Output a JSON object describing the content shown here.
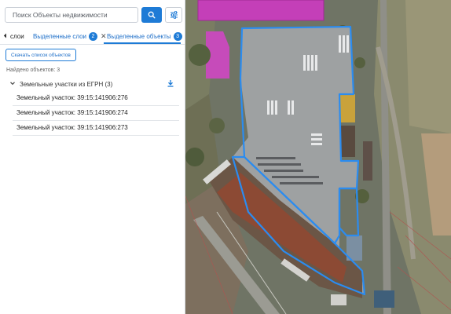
{
  "search": {
    "placeholder": "Поиск Объекты недвижимости"
  },
  "icons": {
    "search": "search-icon",
    "filter": "tune-icon",
    "back": "caret-left-icon",
    "close": "close-icon",
    "expand": "chevron-down-icon",
    "download": "download-icon"
  },
  "tabs": {
    "back_label": "слои",
    "layers_label": "Выделенные слои",
    "layers_count": "2",
    "objects_label": "Выделенные объекты",
    "objects_count": "3"
  },
  "actions": {
    "download_label": "Скачать список объектов"
  },
  "results": {
    "found_label": "Найдено объектов: 3",
    "group_label": "Земельные участки из ЕГРН (3)",
    "items": [
      "Земельный участок: 39:15:141906:276",
      "Земельный участок: 39:15:141906:274",
      "Земельный участок: 39:15:141906:273"
    ]
  },
  "colors": {
    "accent": "#1e7bd6",
    "parcel_outline": "#2b8cf0",
    "roof_magenta": "#c43fb8"
  }
}
